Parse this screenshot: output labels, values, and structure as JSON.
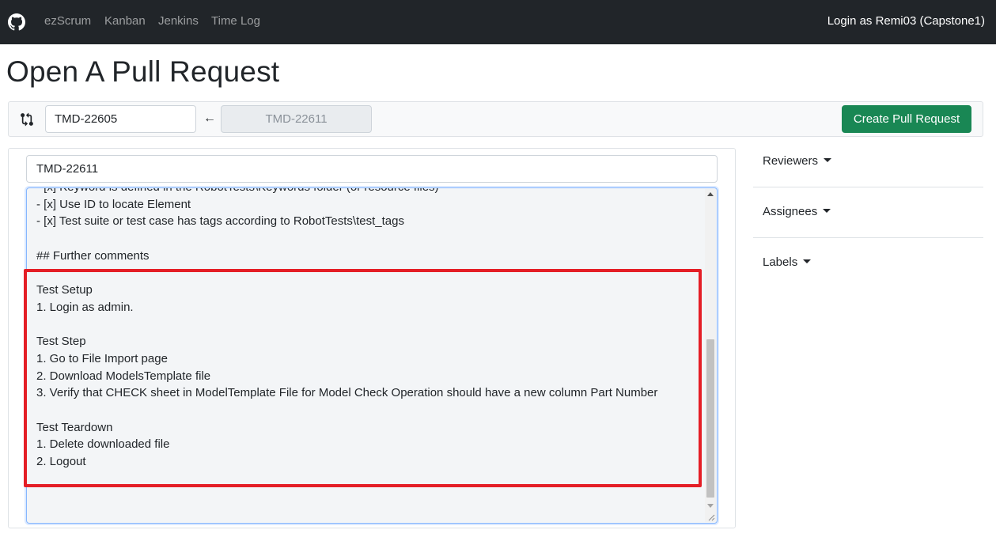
{
  "navbar": {
    "logo_icon": "github-icon",
    "links": [
      "ezScrum",
      "Kanban",
      "Jenkins",
      "Time Log"
    ],
    "login_text": "Login as Remi03 (Capstone1)"
  },
  "page": {
    "title": "Open A Pull Request"
  },
  "branch_bar": {
    "compare_icon": "git-compare-icon",
    "base_branch": "TMD-22605",
    "arrow": "←",
    "head_branch": "TMD-22611",
    "create_button": "Create Pull Request",
    "accent_color": "#198754"
  },
  "form": {
    "title_value": "TMD-22611",
    "body_lines": [
      "- [x] Keyword is defined in the RobotTests\\Keywords folder (or resource files)",
      "- [x] Use ID to locate Element",
      "- [x] Test suite or test case has tags according to RobotTests\\test_tags",
      "",
      "## Further comments",
      "",
      "Test Setup",
      "1. Login as admin.",
      "",
      "Test Step",
      "1. Go to File Import page",
      "2. Download ModelsTemplate file",
      "3. Verify that CHECK sheet in ModelTemplate File for Model Check Operation should have a new column Part Number",
      "",
      "Test Teardown",
      "1. Delete downloaded file",
      "2. Logout"
    ],
    "highlight_color": "#e41e26"
  },
  "sidebar": {
    "reviewers": "Reviewers",
    "assignees": "Assignees",
    "labels": "Labels"
  }
}
